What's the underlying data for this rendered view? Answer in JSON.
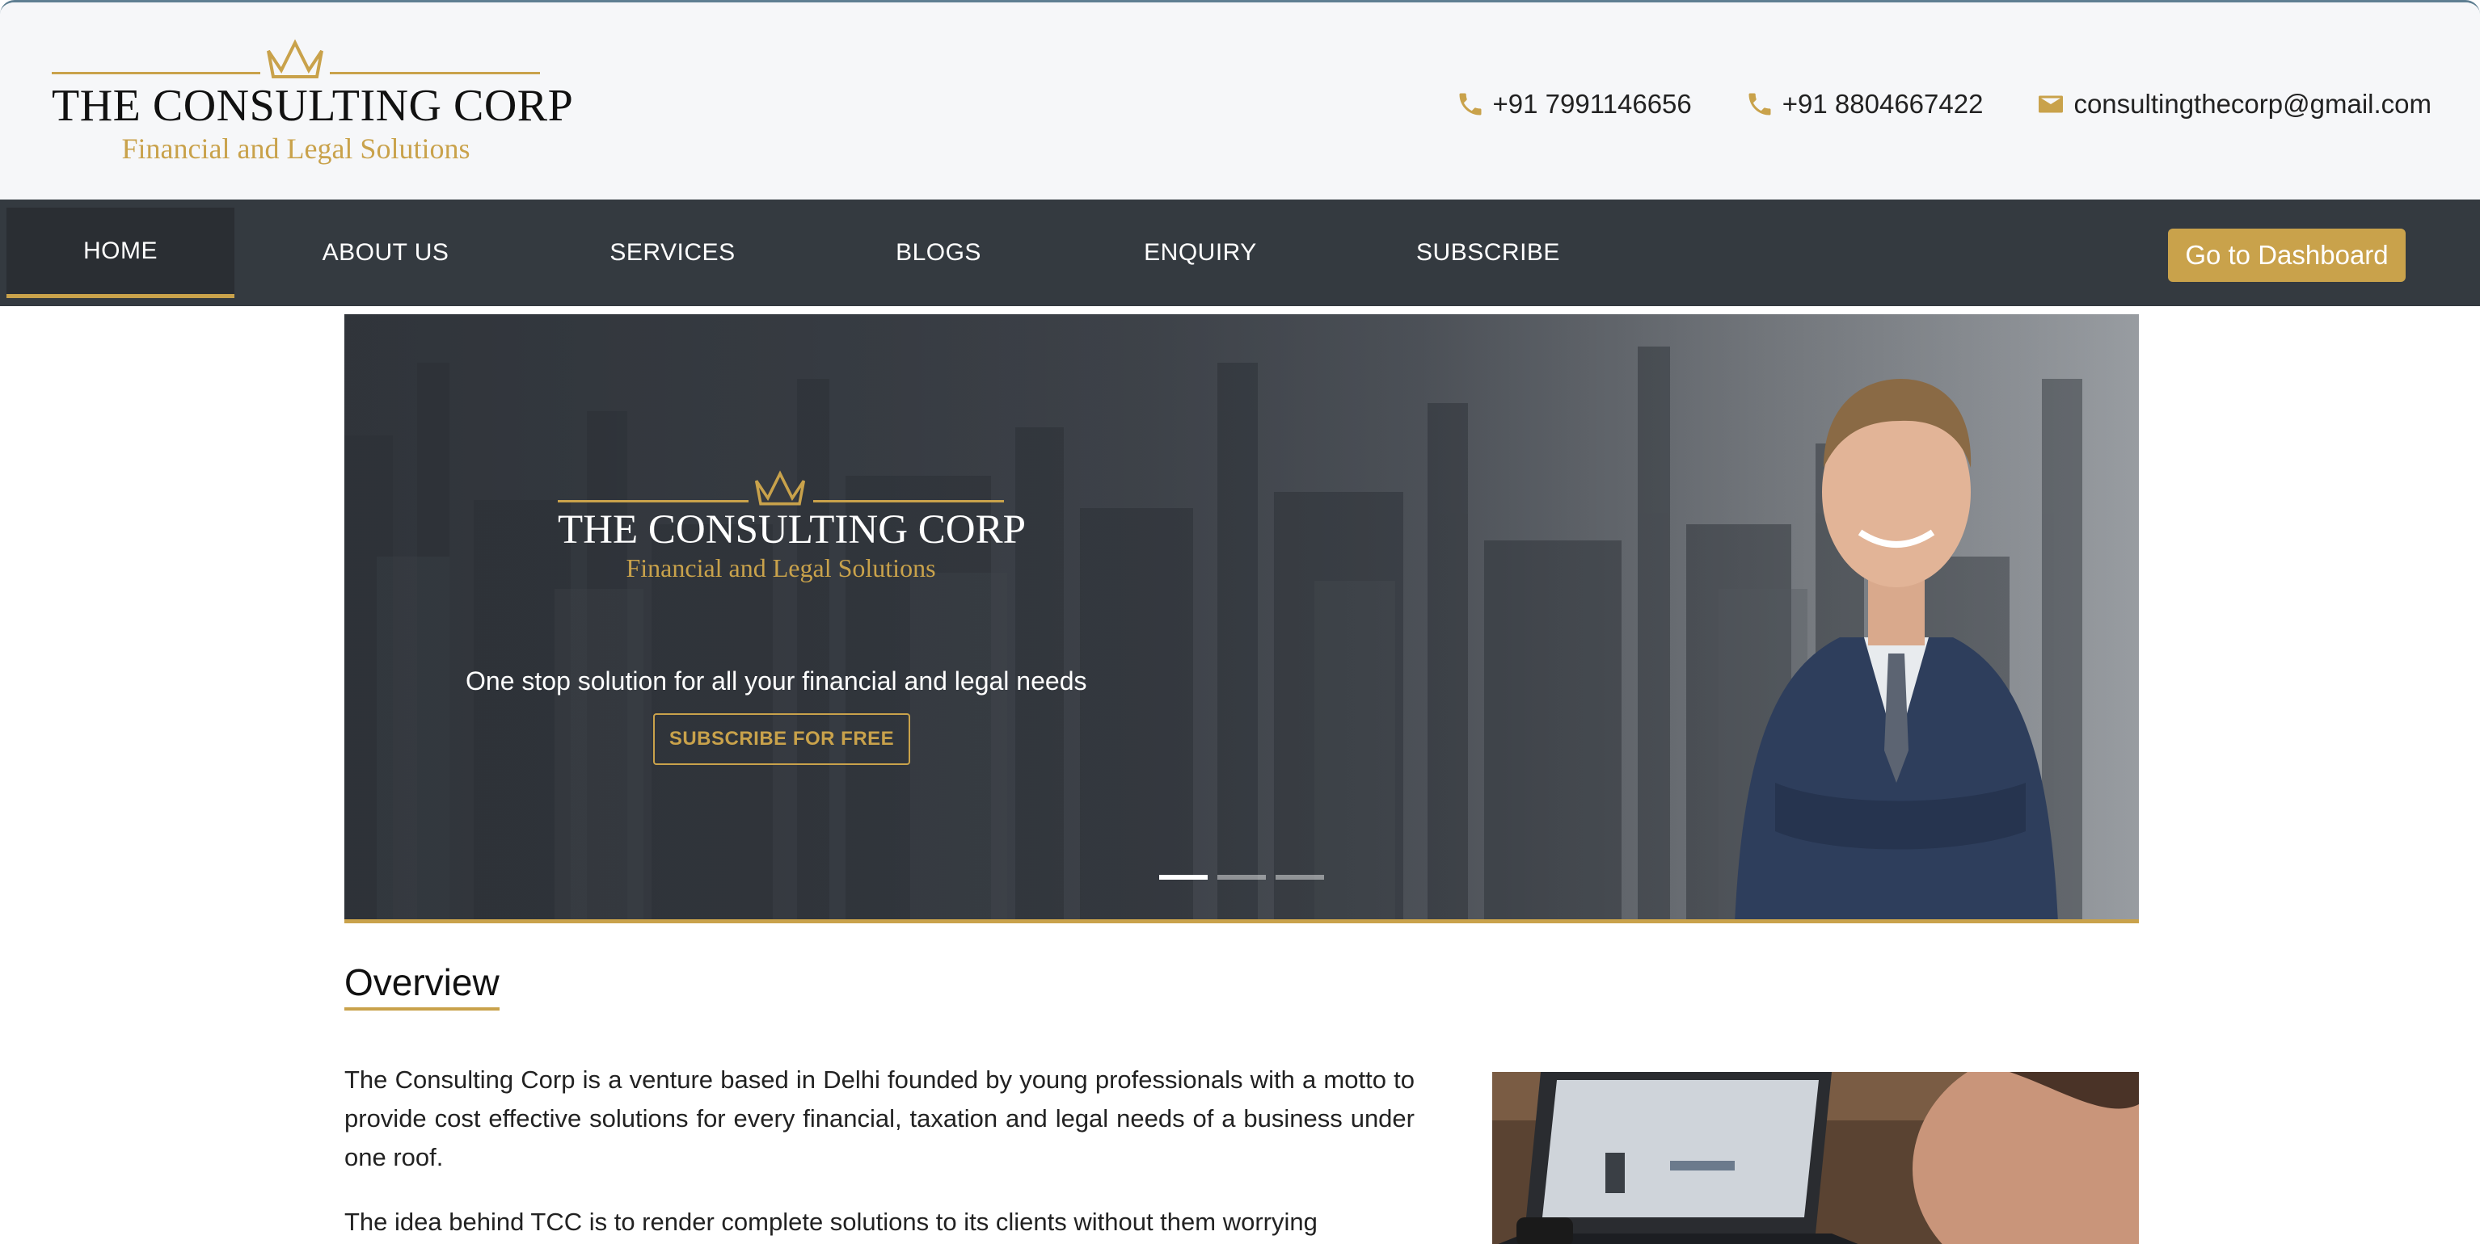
{
  "brand": {
    "name_line": "THE CONSULTING CORP",
    "tagline": "Financial and Legal Solutions",
    "accent_color": "#c9a24b",
    "crown_icon": "crown-icon"
  },
  "header": {
    "contacts": [
      {
        "icon": "phone-icon",
        "text": "+91 7991146656"
      },
      {
        "icon": "phone-icon",
        "text": "+91 8804667422"
      },
      {
        "icon": "mail-icon",
        "text": "consultingthecorp@gmail.com"
      }
    ]
  },
  "nav": {
    "items": [
      {
        "label": "HOME",
        "active": true
      },
      {
        "label": "ABOUT US",
        "active": false
      },
      {
        "label": "SERVICES",
        "active": false
      },
      {
        "label": "BLOGS",
        "active": false
      },
      {
        "label": "ENQUIRY",
        "active": false
      },
      {
        "label": "SUBSCRIBE",
        "active": false
      }
    ],
    "dashboard_button": "Go to Dashboard",
    "background_color": "#343a40"
  },
  "hero": {
    "brand_name": "THE CONSULTING CORP",
    "brand_tagline": "Financial and Legal Solutions",
    "tagline": "One stop solution for all your financial and legal needs",
    "cta": "SUBSCRIBE FOR FREE",
    "slides_total": 3,
    "active_slide": 1
  },
  "overview": {
    "title": "Overview",
    "paragraphs": [
      "The Consulting Corp is a venture based in Delhi founded by young professionals with a motto to provide cost effective solutions for every financial, taxation and legal needs of a business under one roof.",
      "The idea behind TCC is to render complete solutions to its clients without them worrying"
    ]
  }
}
